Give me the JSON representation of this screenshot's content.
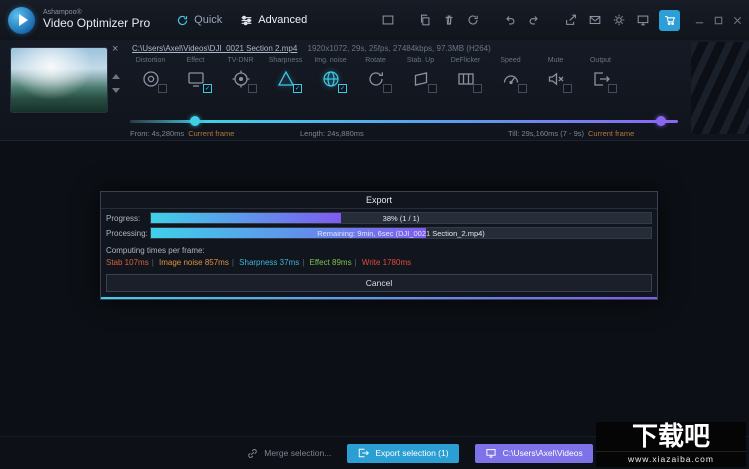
{
  "titlebar": {
    "brand": "Ashampoo®",
    "app_title": "Video Optimizer Pro",
    "tabs": [
      {
        "label": "Quick"
      },
      {
        "label": "Advanced"
      }
    ]
  },
  "clip": {
    "path": "C:\\Users\\Axel\\Videos\\DJI_0021 Section 2.mp4",
    "info": "1920x1072, 29s, 25fps, 27484kbps, 97.3MB (H264)"
  },
  "tools": [
    {
      "label": "Distortion"
    },
    {
      "label": "Effect"
    },
    {
      "label": "TV-DNR"
    },
    {
      "label": "Sharpness"
    },
    {
      "label": "Img. noise"
    },
    {
      "label": "Rotate"
    },
    {
      "label": "Stab. Up"
    },
    {
      "label": "DeFlicker"
    },
    {
      "label": "Speed"
    },
    {
      "label": "Mute"
    },
    {
      "label": "Output"
    }
  ],
  "timeline": {
    "from": "From: 4s,280ms",
    "from_tag": "Current frame",
    "length": "Length: 24s,880ms",
    "till": "Till: 29s,160ms (7 - 9s)",
    "till_tag": "Current frame"
  },
  "export_dialog": {
    "title": "Export",
    "progress": {
      "label": "Progress:",
      "text": "38% (1 / 1)",
      "fill": "38%"
    },
    "processing": {
      "label": "Processing:",
      "text": "Remaining: 9min, 6sec (DJI_0021 Section_2.mp4)",
      "fill": "55%"
    },
    "computing_label": "Computing times per frame:",
    "separator": "|",
    "timings": [
      {
        "text": "Stab 107ms",
        "color": "#d95f3b"
      },
      {
        "text": "Image noise 857ms",
        "color": "#e0923c"
      },
      {
        "text": "Sharpness 37ms",
        "color": "#3fb6d8"
      },
      {
        "text": "Effect 89ms",
        "color": "#7dc24e"
      },
      {
        "text": "Write 1780ms",
        "color": "#e04b3b"
      }
    ],
    "cancel_label": "Cancel"
  },
  "footer": {
    "merge_label": "Merge selection...",
    "export_label": "Export selection (1)",
    "path_label": "C:\\Users\\Axel\\Videos"
  },
  "watermark": {
    "name": "下载吧",
    "url": "www.xiazaiba.com"
  },
  "colors": {
    "accent_cyan": "#3fd0e8",
    "accent_purple": "#7e5bf0",
    "export_button": "#2b9fd4",
    "path_button": "#7e72e8",
    "tag_orange": "#b5763a"
  }
}
